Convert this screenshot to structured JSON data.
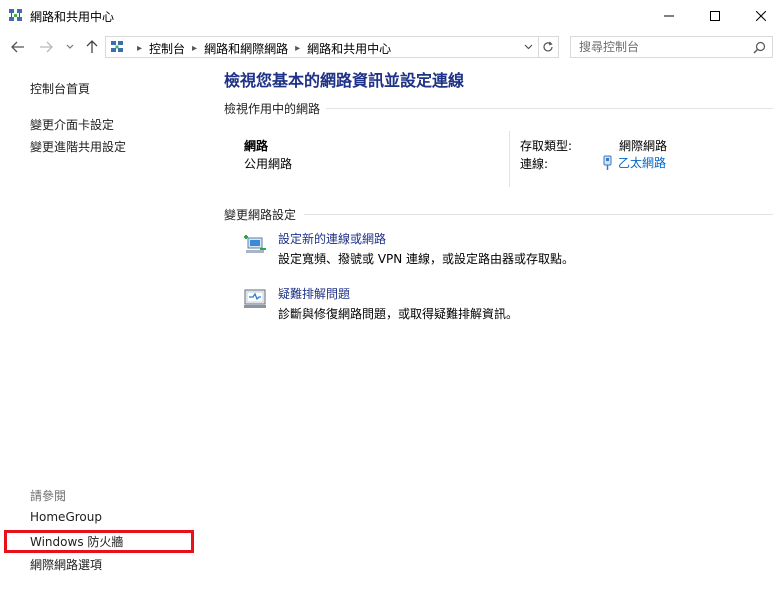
{
  "window": {
    "title": "網路和共用中心",
    "icon": "network-center-icon"
  },
  "navbar": {
    "breadcrumbs": [
      "控制台",
      "網路和網際網路",
      "網路和共用中心"
    ],
    "search_placeholder": "搜尋控制台"
  },
  "sidebar": {
    "items": [
      {
        "label": "控制台首頁"
      },
      {
        "label": "變更介面卡設定"
      },
      {
        "label": "變更進階共用設定"
      }
    ],
    "see_also_label": "請參閱",
    "see_also": [
      {
        "label": "HomeGroup"
      },
      {
        "label": "Windows 防火牆"
      },
      {
        "label": "網際網路選項"
      }
    ]
  },
  "main": {
    "title": "檢視您基本的網路資訊並設定連線",
    "active_networks": {
      "heading": "檢視作用中的網路",
      "network_name": "網路",
      "network_category": "公用網路",
      "access_type_label": "存取類型:",
      "access_type_value": "網際網路",
      "connections_label": "連線:",
      "connection_value": "乙太網路"
    },
    "change_settings": {
      "heading": "變更網路設定",
      "tasks": [
        {
          "link": "設定新的連線或網路",
          "desc": "設定寬頻、撥號或 VPN 連線，或設定路由器或存取點。",
          "icon": "new-connection-icon"
        },
        {
          "link": "疑難排解問題",
          "desc": "診斷與修復網路問題，或取得疑難排解資訊。",
          "icon": "troubleshoot-icon"
        }
      ]
    }
  },
  "colors": {
    "title_blue": "#1e3287",
    "link_blue": "#0066cc",
    "highlight_red": "#e8101a"
  }
}
